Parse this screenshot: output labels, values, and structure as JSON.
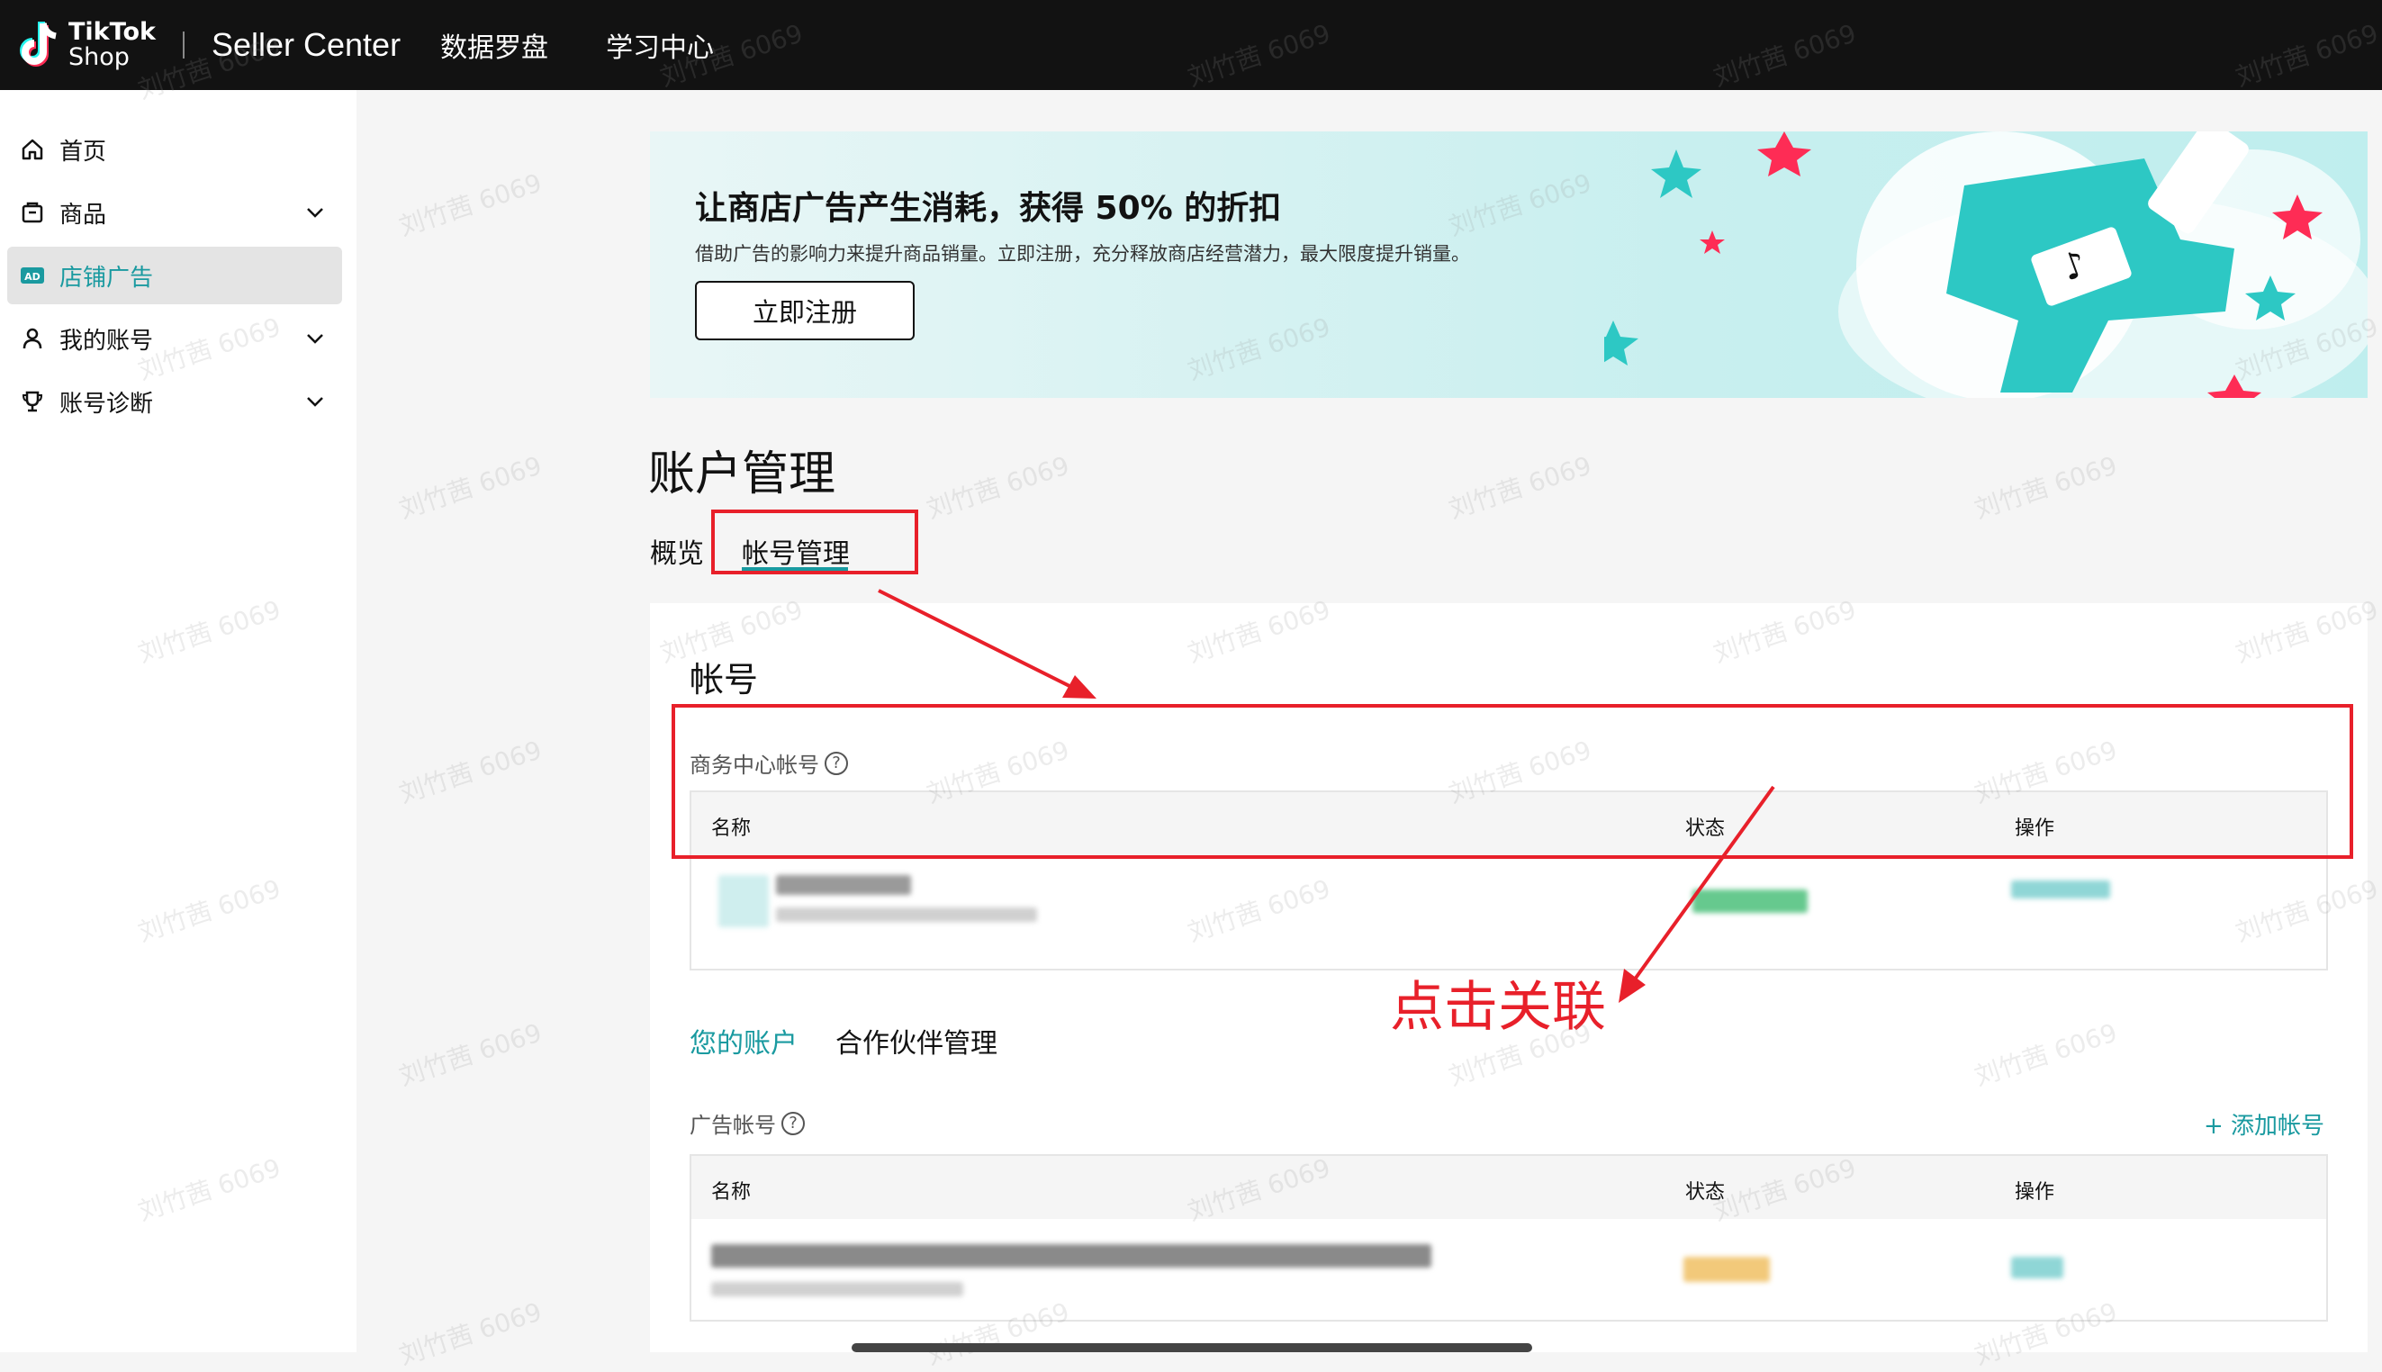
{
  "header": {
    "logo_line1": "TikTok",
    "logo_line2": "Shop",
    "title": "Seller Center",
    "nav": [
      "数据罗盘",
      "学习中心"
    ]
  },
  "sidebar": {
    "items": [
      {
        "label": "首页",
        "icon": "home-icon",
        "expandable": false,
        "active": false
      },
      {
        "label": "商品",
        "icon": "product-icon",
        "expandable": true,
        "active": false
      },
      {
        "label": "店铺广告",
        "icon": "ad-icon",
        "expandable": false,
        "active": true
      },
      {
        "label": "我的账号",
        "icon": "user-icon",
        "expandable": true,
        "active": false
      },
      {
        "label": "账号诊断",
        "icon": "trophy-icon",
        "expandable": true,
        "active": false
      }
    ]
  },
  "banner": {
    "title": "让商店广告产生消耗，获得 50% 的折扣",
    "subtitle": "借助广告的影响力来提升商品销量。立即注册，充分释放商店经营潜力，最大限度提升销量。",
    "button": "立即注册"
  },
  "page": {
    "title": "账户管理",
    "tabs": [
      "概览",
      "帐号管理"
    ],
    "active_tab": "帐号管理"
  },
  "account_section": {
    "title": "帐号",
    "business_center_label": "商务中心帐号",
    "columns": [
      "名称",
      "状态",
      "操作"
    ],
    "sub_tabs": [
      "您的账户",
      "合作伙伴管理"
    ],
    "active_sub_tab": "您的账户",
    "ad_account_label": "广告帐号",
    "add_account": "+ 添加帐号",
    "ad_columns": [
      "名称",
      "状态",
      "操作"
    ]
  },
  "annotation": {
    "text": "点击关联"
  },
  "watermark": "刘竹茜 6069",
  "colors": {
    "accent": "#1a9aa0",
    "annotation_red": "#e8202a",
    "topbar": "#121212"
  }
}
